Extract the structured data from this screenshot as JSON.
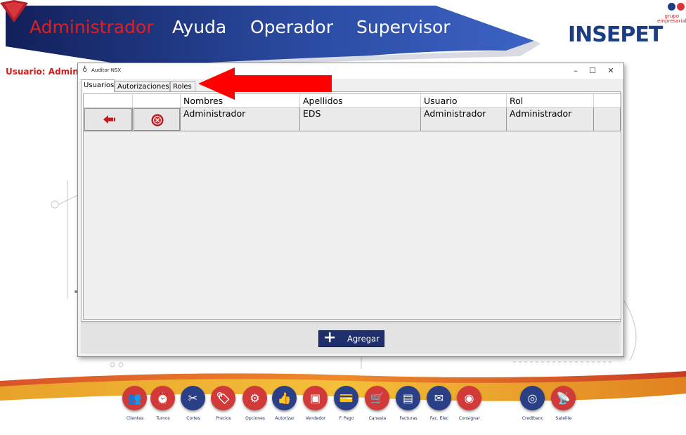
{
  "menu": {
    "items": [
      "Administrador",
      "Ayuda",
      "Operador",
      "Supervisor"
    ],
    "active": "Administrador"
  },
  "brand": {
    "logo_text": "INSEPET",
    "group_line1": "grupo",
    "group_line2": "empresarial"
  },
  "user_label": "Usuario: Administrador",
  "dialog": {
    "title": "Auditor NSX",
    "minimize_glyph": "–",
    "maximize_glyph": "☐",
    "close_glyph": "✕",
    "tabs": [
      "Usuarios",
      "Autorizaciones",
      "Roles"
    ],
    "selected_tab": "Usuarios",
    "columns": [
      "Nombres",
      "Apellidos",
      "Usuario",
      "Rol"
    ],
    "rows": [
      {
        "nombres": "Administrador",
        "apellidos": "EDS",
        "usuario": "Administrador",
        "rol": "Administrador"
      }
    ],
    "add_button_icon": "+",
    "add_button_label": "Agregar"
  },
  "toolbar": [
    {
      "label": "Clientes",
      "icon": "users-icon",
      "glyph": "👥",
      "color": "#d23a3a"
    },
    {
      "label": "Turnos",
      "icon": "alarm-clock-icon",
      "glyph": "⏰",
      "color": "#d23a3a"
    },
    {
      "label": "Cortes",
      "icon": "scissors-icon",
      "glyph": "✂",
      "color": "#2b3f86"
    },
    {
      "label": "Precios",
      "icon": "tag-icon",
      "glyph": "🏷",
      "color": "#d23a3a"
    },
    {
      "label": "Opciones",
      "icon": "gears-icon",
      "glyph": "⚙",
      "color": "#d23a3a"
    },
    {
      "label": "Autorizar",
      "icon": "thumbs-up-icon",
      "glyph": "👍",
      "color": "#2b3f86"
    },
    {
      "label": "Vendedor",
      "icon": "id-card-icon",
      "glyph": "▣",
      "color": "#d23a3a"
    },
    {
      "label": "F. Pago",
      "icon": "payment-icon",
      "glyph": "💳",
      "color": "#2b3f86"
    },
    {
      "label": "Canasta",
      "icon": "cart-icon",
      "glyph": "🛒",
      "color": "#d23a3a"
    },
    {
      "label": "Facturas",
      "icon": "invoice-icon",
      "glyph": "▤",
      "color": "#2b3f86"
    },
    {
      "label": "Fac. Elec",
      "icon": "e-invoice-icon",
      "glyph": "✉",
      "color": "#2b3f86"
    },
    {
      "label": "Consignar",
      "icon": "safe-icon",
      "glyph": "◉",
      "color": "#d23a3a"
    },
    {
      "label": "Credibanc",
      "icon": "credibanco-icon",
      "glyph": "◎",
      "color": "#2b3f86"
    },
    {
      "label": "Satelite",
      "icon": "satellite-icon",
      "glyph": "📡",
      "color": "#d23a3a"
    }
  ]
}
